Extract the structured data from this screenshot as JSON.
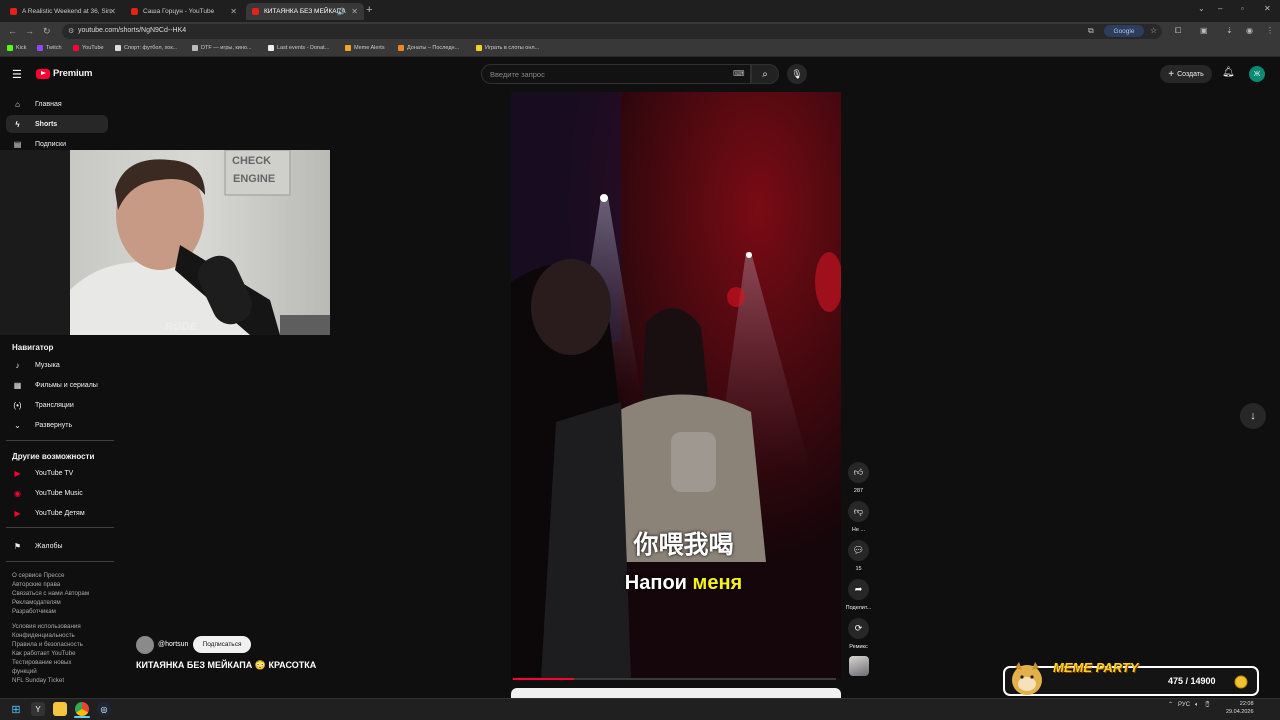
{
  "browser": {
    "tabs": [
      {
        "title": "A Realistic Weekend at 36, Sin",
        "active": false
      },
      {
        "title": "Саша Горцун - YouTube",
        "active": false
      },
      {
        "title": "КИТАЯНКА БЕЗ МЕЙКАПА",
        "active": true
      }
    ],
    "url": "youtube.com/shorts/NgN9Cd--HK4",
    "search_chip": "Google",
    "bookmarks": [
      "Kick",
      "Twitch",
      "YouTube",
      "Спорт: футбол, хок...",
      "DTF — игры, кино...",
      "Last events - Donat...",
      "Meme Alerts",
      "Донаты – Последн...",
      "Играть в слоты онл..."
    ]
  },
  "yt": {
    "logo_text": "Premium",
    "search_placeholder": "Введите запрос",
    "create_label": "Создать",
    "avatar_letter": "Ж",
    "sidebar": {
      "home": "Главная",
      "shorts": "Shorts",
      "subs": "Подписки",
      "navigator_heading": "Навигатор",
      "navigator": [
        "Музыка",
        "Фильмы и сериалы",
        "Трансляции",
        "Развернуть"
      ],
      "more_heading": "Другие возможности",
      "more": [
        "YouTube TV",
        "YouTube Music",
        "YouTube Детям"
      ],
      "reports": "Жалобы",
      "footer1": [
        "О сервисе  Прессе",
        "Авторские права",
        "Связаться с нами  Авторам",
        "Рекламодателям",
        "Разработчикам"
      ],
      "footer2": [
        "Условия использования",
        "Конфиденциальность",
        "Правила и безопасность",
        "Как работает YouTube",
        "Тестирование новых",
        "функций",
        "NFL Sunday Ticket"
      ]
    },
    "short": {
      "subtitle_cn": "你喂我喝",
      "subtitle_ru_1": "Напои",
      "subtitle_ru_2": "меня",
      "channel": "@hortsun",
      "subscribe_label": "Подписаться",
      "title": "КИТАЯНКА БЕЗ МЕЙКАПА 😳 КРАСОТКА",
      "likes": "287",
      "dislike_label": "Не ...",
      "comments": "15",
      "share_label": "Поделит...",
      "remix_label": "Ремикс",
      "progress": 0.19
    }
  },
  "overlay": {
    "meme_title": "MEME PARTY",
    "meme_progress_text": "475 / 14900"
  },
  "taskbar": {
    "lang": "РУС",
    "time": "22:08",
    "date": "29.04.2026"
  }
}
